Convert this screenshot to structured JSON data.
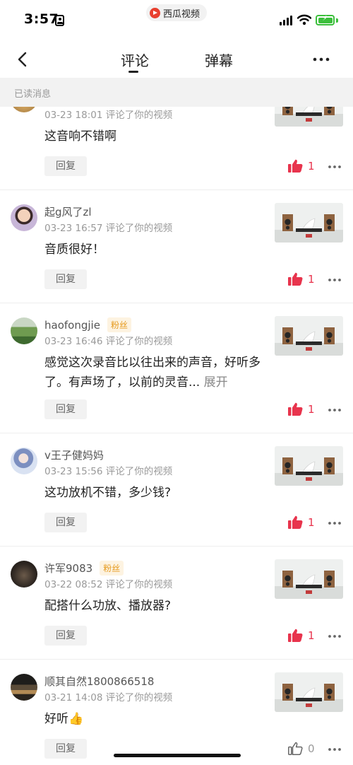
{
  "status_bar": {
    "time": "3:57",
    "app_name": "西瓜视频"
  },
  "nav": {
    "tabs": [
      {
        "label": "评论",
        "active": true
      },
      {
        "label": "弹幕",
        "active": false
      }
    ]
  },
  "section": {
    "title": "已读消息"
  },
  "comments": [
    {
      "user": "",
      "fan_badge": "",
      "date": "03-23 18:01",
      "action": "评论了你的视频",
      "text": "这音响不错啊",
      "expand": "",
      "reply_label": "回复",
      "likes": "1",
      "liked": true
    },
    {
      "user": "起g风了zl",
      "fan_badge": "",
      "date": "03-23 16:57",
      "action": "评论了你的视频",
      "text": "音质很好！",
      "expand": "",
      "reply_label": "回复",
      "likes": "1",
      "liked": true
    },
    {
      "user": "haofongjie",
      "fan_badge": "粉丝",
      "date": "03-23 16:46",
      "action": "评论了你的视频",
      "text": "感觉这次录音比以往出来的声音，好听多了。有声场了，以前的灵音...",
      "expand": "展开",
      "reply_label": "回复",
      "likes": "1",
      "liked": true
    },
    {
      "user": "v王子健妈妈",
      "fan_badge": "",
      "date": "03-23 15:56",
      "action": "评论了你的视频",
      "text": "这功放机不错，多少钱?",
      "expand": "",
      "reply_label": "回复",
      "likes": "1",
      "liked": true
    },
    {
      "user": "许军9083",
      "fan_badge": "粉丝",
      "date": "03-22 08:52",
      "action": "评论了你的视频",
      "text": "配搭什么功放、播放器?",
      "expand": "",
      "reply_label": "回复",
      "likes": "1",
      "liked": true
    },
    {
      "user": "顺其自然1800866518",
      "fan_badge": "",
      "date": "03-21 14:08",
      "action": "评论了你的视频",
      "text": "好听👍",
      "expand": "",
      "reply_label": "回复",
      "likes": "0",
      "liked": false
    }
  ],
  "colors": {
    "accent_red": "#e8344d",
    "fan_badge": "#e69a1e",
    "battery": "#3bbf3b"
  }
}
